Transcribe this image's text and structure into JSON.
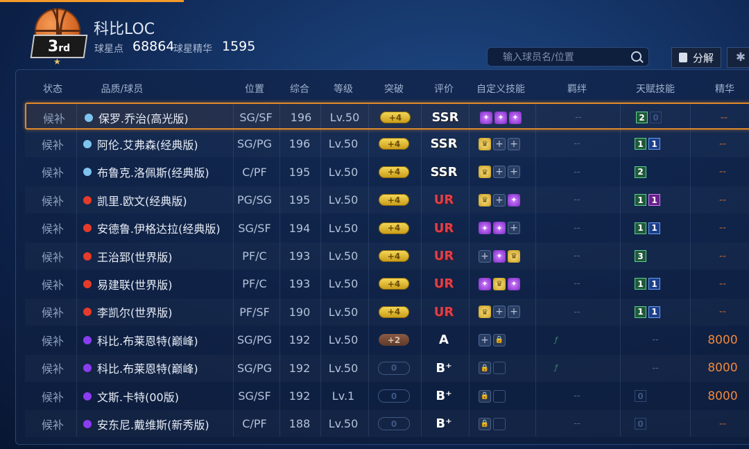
{
  "player": {
    "name": "科比LOC",
    "rank_main": "3",
    "rank_suffix": "rd",
    "star_points_label": "球星点",
    "star_points": "68864",
    "essence_label": "球星精华",
    "essence": "1595"
  },
  "search": {
    "placeholder": "输入球员名/位置"
  },
  "buttons": {
    "decompose": "分解",
    "more": "✱"
  },
  "headers": [
    "状态",
    "品质/球员",
    "位置",
    "综合",
    "等级",
    "突破",
    "评价",
    "自定义技能",
    "羁绊",
    "天赋技能",
    "精华"
  ],
  "colors": {
    "accent": "#e08a28",
    "grade_ur": "#e04048",
    "essence": "#f0883c"
  },
  "rows": [
    {
      "status": "候补",
      "quality": "blue",
      "name": "保罗.乔治(高光版)",
      "pos": "SG/SF",
      "ovr": "196",
      "level": "Lv.50",
      "breakthrough": "+4",
      "bt_style": "gold",
      "grade": "SSR",
      "grade_style": "ssr",
      "skills": [
        "purple",
        "purple",
        "purple"
      ],
      "bond": "--",
      "talents": [
        {
          "v": "2",
          "s": "green"
        },
        {
          "v": "0",
          "s": "empty"
        }
      ],
      "essence": "--",
      "selected": true
    },
    {
      "status": "候补",
      "quality": "blue",
      "name": "阿伦.艾弗森(经典版)",
      "pos": "SG/PG",
      "ovr": "196",
      "level": "Lv.50",
      "breakthrough": "+4",
      "bt_style": "gold",
      "grade": "SSR",
      "grade_style": "ssr",
      "skills": [
        "gold",
        "plus",
        "plus"
      ],
      "bond": "--",
      "talents": [
        {
          "v": "1",
          "s": "green"
        },
        {
          "v": "1",
          "s": "blue"
        }
      ],
      "essence": "--"
    },
    {
      "status": "候补",
      "quality": "blue",
      "name": "布鲁克.洛佩斯(经典版)",
      "pos": "C/PF",
      "ovr": "195",
      "level": "Lv.50",
      "breakthrough": "+4",
      "bt_style": "gold",
      "grade": "SSR",
      "grade_style": "ssr",
      "skills": [
        "gold",
        "plus",
        "plus"
      ],
      "bond": "--",
      "talents": [
        {
          "v": "2",
          "s": "green"
        }
      ],
      "essence": "--"
    },
    {
      "status": "候补",
      "quality": "red",
      "name": "凯里.欧文(经典版)",
      "pos": "PG/SG",
      "ovr": "195",
      "level": "Lv.50",
      "breakthrough": "+4",
      "bt_style": "gold",
      "grade": "UR",
      "grade_style": "ur",
      "skills": [
        "gold",
        "plus",
        "purple"
      ],
      "bond": "--",
      "talents": [
        {
          "v": "1",
          "s": "green"
        },
        {
          "v": "1",
          "s": "purple"
        }
      ],
      "essence": "--"
    },
    {
      "status": "候补",
      "quality": "red",
      "name": "安德鲁.伊格达拉(经典版)",
      "pos": "SG/SF",
      "ovr": "194",
      "level": "Lv.50",
      "breakthrough": "+4",
      "bt_style": "gold",
      "grade": "UR",
      "grade_style": "ur",
      "skills": [
        "purple",
        "purple",
        "plus"
      ],
      "bond": "--",
      "talents": [
        {
          "v": "1",
          "s": "green"
        },
        {
          "v": "1",
          "s": "blue"
        }
      ],
      "essence": "--"
    },
    {
      "status": "候补",
      "quality": "red",
      "name": "王治郅(世界版)",
      "pos": "PF/C",
      "ovr": "193",
      "level": "Lv.50",
      "breakthrough": "+4",
      "bt_style": "gold",
      "grade": "UR",
      "grade_style": "ur",
      "skills": [
        "plus",
        "purple",
        "gold"
      ],
      "bond": "--",
      "talents": [
        {
          "v": "3",
          "s": "green"
        }
      ],
      "essence": "--"
    },
    {
      "status": "候补",
      "quality": "red",
      "name": "易建联(世界版)",
      "pos": "PF/C",
      "ovr": "193",
      "level": "Lv.50",
      "breakthrough": "+4",
      "bt_style": "gold",
      "grade": "UR",
      "grade_style": "ur",
      "skills": [
        "purple",
        "gold",
        "purple"
      ],
      "bond": "--",
      "talents": [
        {
          "v": "1",
          "s": "green"
        },
        {
          "v": "1",
          "s": "blue"
        }
      ],
      "essence": "--"
    },
    {
      "status": "候补",
      "quality": "red",
      "name": "李凯尔(世界版)",
      "pos": "PF/SF",
      "ovr": "190",
      "level": "Lv.50",
      "breakthrough": "+4",
      "bt_style": "gold",
      "grade": "UR",
      "grade_style": "ur",
      "skills": [
        "gold",
        "plus",
        "plus"
      ],
      "bond": "--",
      "talents": [
        {
          "v": "1",
          "s": "green"
        },
        {
          "v": "1",
          "s": "blue"
        }
      ],
      "essence": "--"
    },
    {
      "status": "候补",
      "quality": "violet",
      "name": "科比.布莱恩特(巅峰)",
      "pos": "SG/PG",
      "ovr": "192",
      "level": "Lv.50",
      "breakthrough": "+2",
      "bt_style": "bronze",
      "grade": "A",
      "grade_style": "a",
      "skills": [
        "plus",
        "lock"
      ],
      "bond": "icon",
      "talents": [],
      "talent_text": "--",
      "essence": "8000"
    },
    {
      "status": "候补",
      "quality": "violet",
      "name": "科比.布莱恩特(巅峰)",
      "pos": "SG/PG",
      "ovr": "192",
      "level": "Lv.50",
      "breakthrough": "0",
      "bt_style": "empty",
      "grade": "B⁺",
      "grade_style": "b",
      "skills": [
        "lock",
        "blank"
      ],
      "bond": "icon",
      "talents": [],
      "talent_text": "--",
      "essence": "8000"
    },
    {
      "status": "候补",
      "quality": "violet",
      "name": "文斯.卡特(00版)",
      "pos": "SG/SF",
      "ovr": "192",
      "level": "Lv.1",
      "breakthrough": "0",
      "bt_style": "empty",
      "grade": "B⁺",
      "grade_style": "b",
      "skills": [
        "lock",
        "blank"
      ],
      "bond": "--",
      "talents": [
        {
          "v": "0",
          "s": "empty"
        }
      ],
      "essence": "8000"
    },
    {
      "status": "候补",
      "quality": "violet",
      "name": "安东尼.戴维斯(新秀版)",
      "pos": "C/PF",
      "ovr": "188",
      "level": "Lv.50",
      "breakthrough": "0",
      "bt_style": "empty",
      "grade": "B⁺",
      "grade_style": "b",
      "skills": [
        "lock",
        "blank"
      ],
      "bond": "--",
      "talents": [
        {
          "v": "0",
          "s": "empty"
        }
      ],
      "essence": "--"
    }
  ]
}
